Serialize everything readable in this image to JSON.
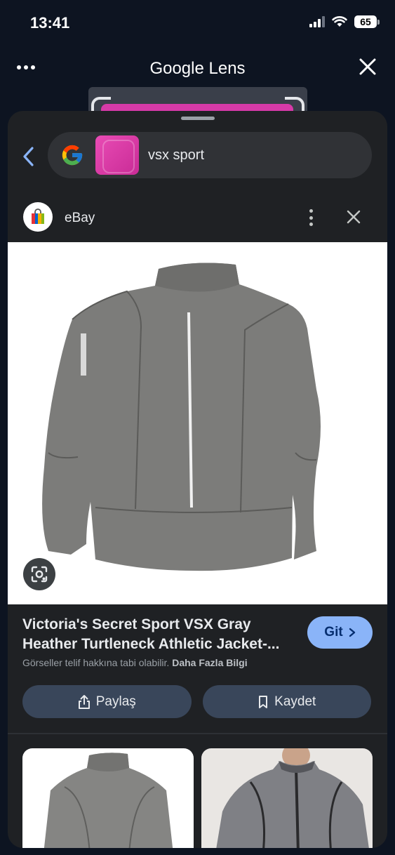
{
  "status_bar": {
    "time": "13:41",
    "battery": "65"
  },
  "header": {
    "title": "Google Lens"
  },
  "search": {
    "query": "vsx sport"
  },
  "source": {
    "name": "eBay"
  },
  "result": {
    "title_line1": "Victoria's Secret Sport VSX Gray",
    "title_line2": "Heather Turtleneck Athletic Jacket-...",
    "go_label": "Git",
    "copyright_text": "Görseller telif hakkına tabi olabilir.",
    "more_info": "Daha Fazla Bilgi",
    "share_label": "Paylaş",
    "save_label": "Kaydet"
  },
  "colors": {
    "background": "#0d1421",
    "sheet": "#1f2124",
    "accent": "#8ab4f8",
    "action_button": "#39465a",
    "thumbnail_pink": "#e94cb5",
    "jacket_gray": "#7a7a78"
  },
  "icons": [
    "more-dots-icon",
    "close-icon",
    "back-arrow-icon",
    "google-g-icon",
    "shopping-bag-icon",
    "kebab-icon",
    "lens-search-icon",
    "chevron-right-icon",
    "share-icon",
    "bookmark-icon"
  ]
}
